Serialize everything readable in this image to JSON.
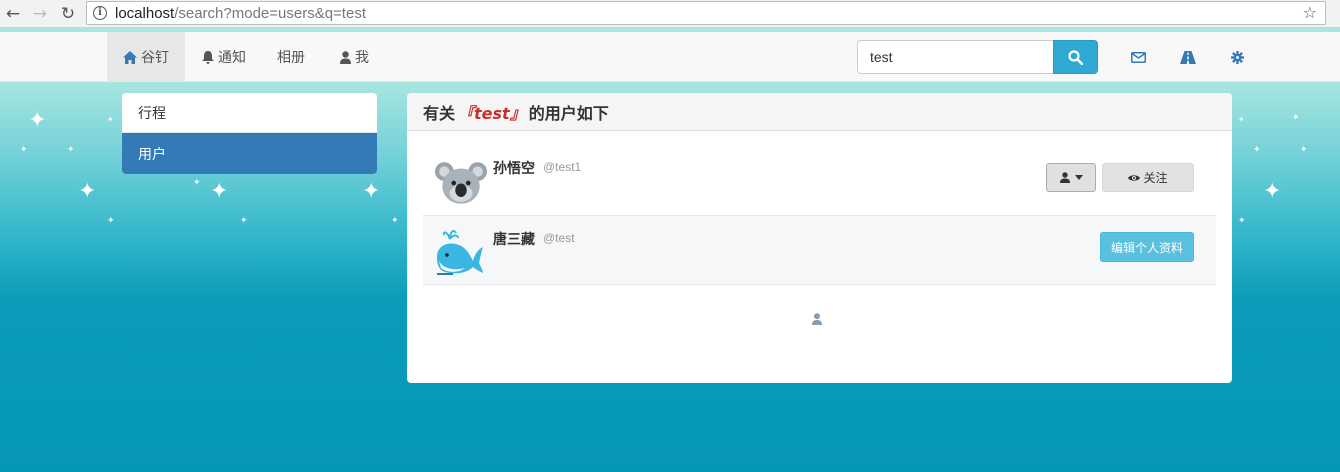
{
  "browser": {
    "url_host": "localhost",
    "url_rest": "/search?mode=users&q=test"
  },
  "navbar": {
    "items": [
      {
        "label": "谷钉",
        "icon": "home-icon"
      },
      {
        "label": "通知",
        "icon": "bell-icon"
      },
      {
        "label": "相册",
        "icon": ""
      },
      {
        "label": "我",
        "icon": "user-icon"
      }
    ],
    "search_value": "test",
    "icons": [
      "envelope-icon",
      "road-icon",
      "gear-icon"
    ]
  },
  "sidebar": {
    "items": [
      {
        "label": "行程",
        "active": false
      },
      {
        "label": "用户",
        "active": true
      }
    ]
  },
  "results": {
    "title_prefix": "有关",
    "query": "『test』",
    "title_suffix": "的用户如下",
    "users": [
      {
        "name": "孙悟空",
        "handle": "@test1",
        "avatar": "koala-icon",
        "action": "关注"
      },
      {
        "name": "唐三藏",
        "handle": "@test",
        "avatar": "whale-icon",
        "action": "编辑个人资料"
      }
    ]
  },
  "colors": {
    "primary": "#337ab7",
    "search_button": "#2fa9d4",
    "info_button": "#5bc0de",
    "query_highlight": "#c9302c"
  }
}
